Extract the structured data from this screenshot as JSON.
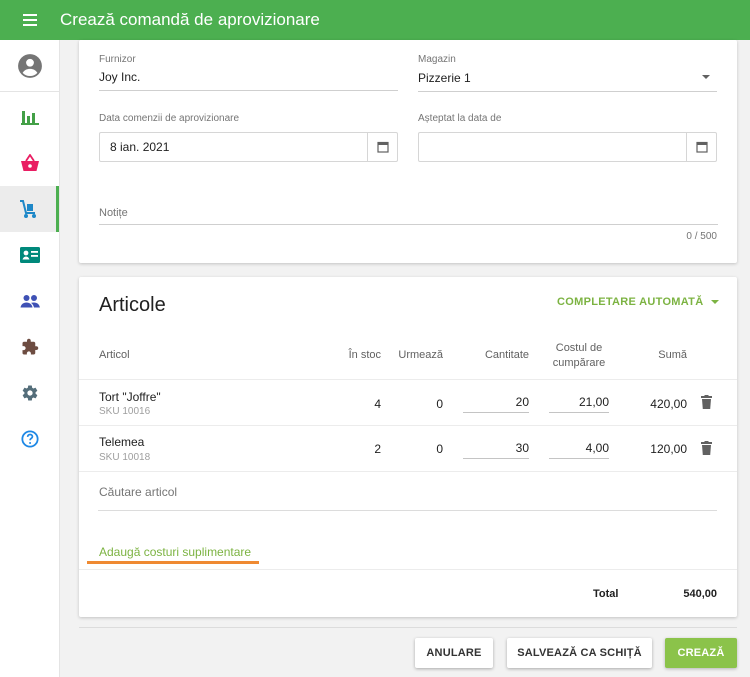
{
  "app": {
    "title": "Crează comandă de aprovizionare"
  },
  "sidebar": {
    "items": [
      {
        "icon": "account-circle-icon"
      },
      {
        "icon": "bar-chart-icon"
      },
      {
        "icon": "basket-icon"
      },
      {
        "icon": "hand-truck-icon",
        "active": true
      },
      {
        "icon": "id-card-icon"
      },
      {
        "icon": "people-icon"
      },
      {
        "icon": "puzzle-icon"
      },
      {
        "icon": "gear-icon"
      },
      {
        "icon": "help-icon"
      }
    ]
  },
  "form": {
    "supplier_label": "Furnizor",
    "supplier_value": "Joy Inc.",
    "store_label": "Magazin",
    "store_value": "Pizzerie 1",
    "order_date_label": "Data comenzii de aprovizionare",
    "order_date_value": "8 ian. 2021",
    "expected_date_label": "Așteptat la data de",
    "expected_date_value": "",
    "notes_label": "Notițe",
    "notes_counter": "0 / 500"
  },
  "items_section": {
    "title": "Articole",
    "autofill_label": "COMPLETARE AUTOMATĂ",
    "headers": {
      "item": "Articol",
      "in_stock": "În stoc",
      "incoming": "Urmează",
      "quantity": "Cantitate",
      "cost_line1": "Costul de",
      "cost_line2": "cumpărare",
      "amount": "Sumă"
    },
    "rows": [
      {
        "name": "Tort \"Joffre\"",
        "sku": "SKU 10016",
        "in_stock": "4",
        "incoming": "0",
        "quantity": "20",
        "cost": "21,00",
        "amount": "420,00"
      },
      {
        "name": "Telemea",
        "sku": "SKU 10018",
        "in_stock": "2",
        "incoming": "0",
        "quantity": "30",
        "cost": "4,00",
        "amount": "120,00"
      }
    ],
    "search_placeholder": "Căutare articol",
    "add_costs_label": "Adaugă costuri suplimentare",
    "total_label": "Total",
    "total_value": "540,00"
  },
  "actions": {
    "cancel": "ANULARE",
    "save_draft": "SALVEAZĂ CA SCHIȚĂ",
    "create": "CREAZĂ"
  },
  "colors": {
    "primary": "#4caf50",
    "accent": "#7cb342",
    "highlight": "#ef8a32"
  }
}
